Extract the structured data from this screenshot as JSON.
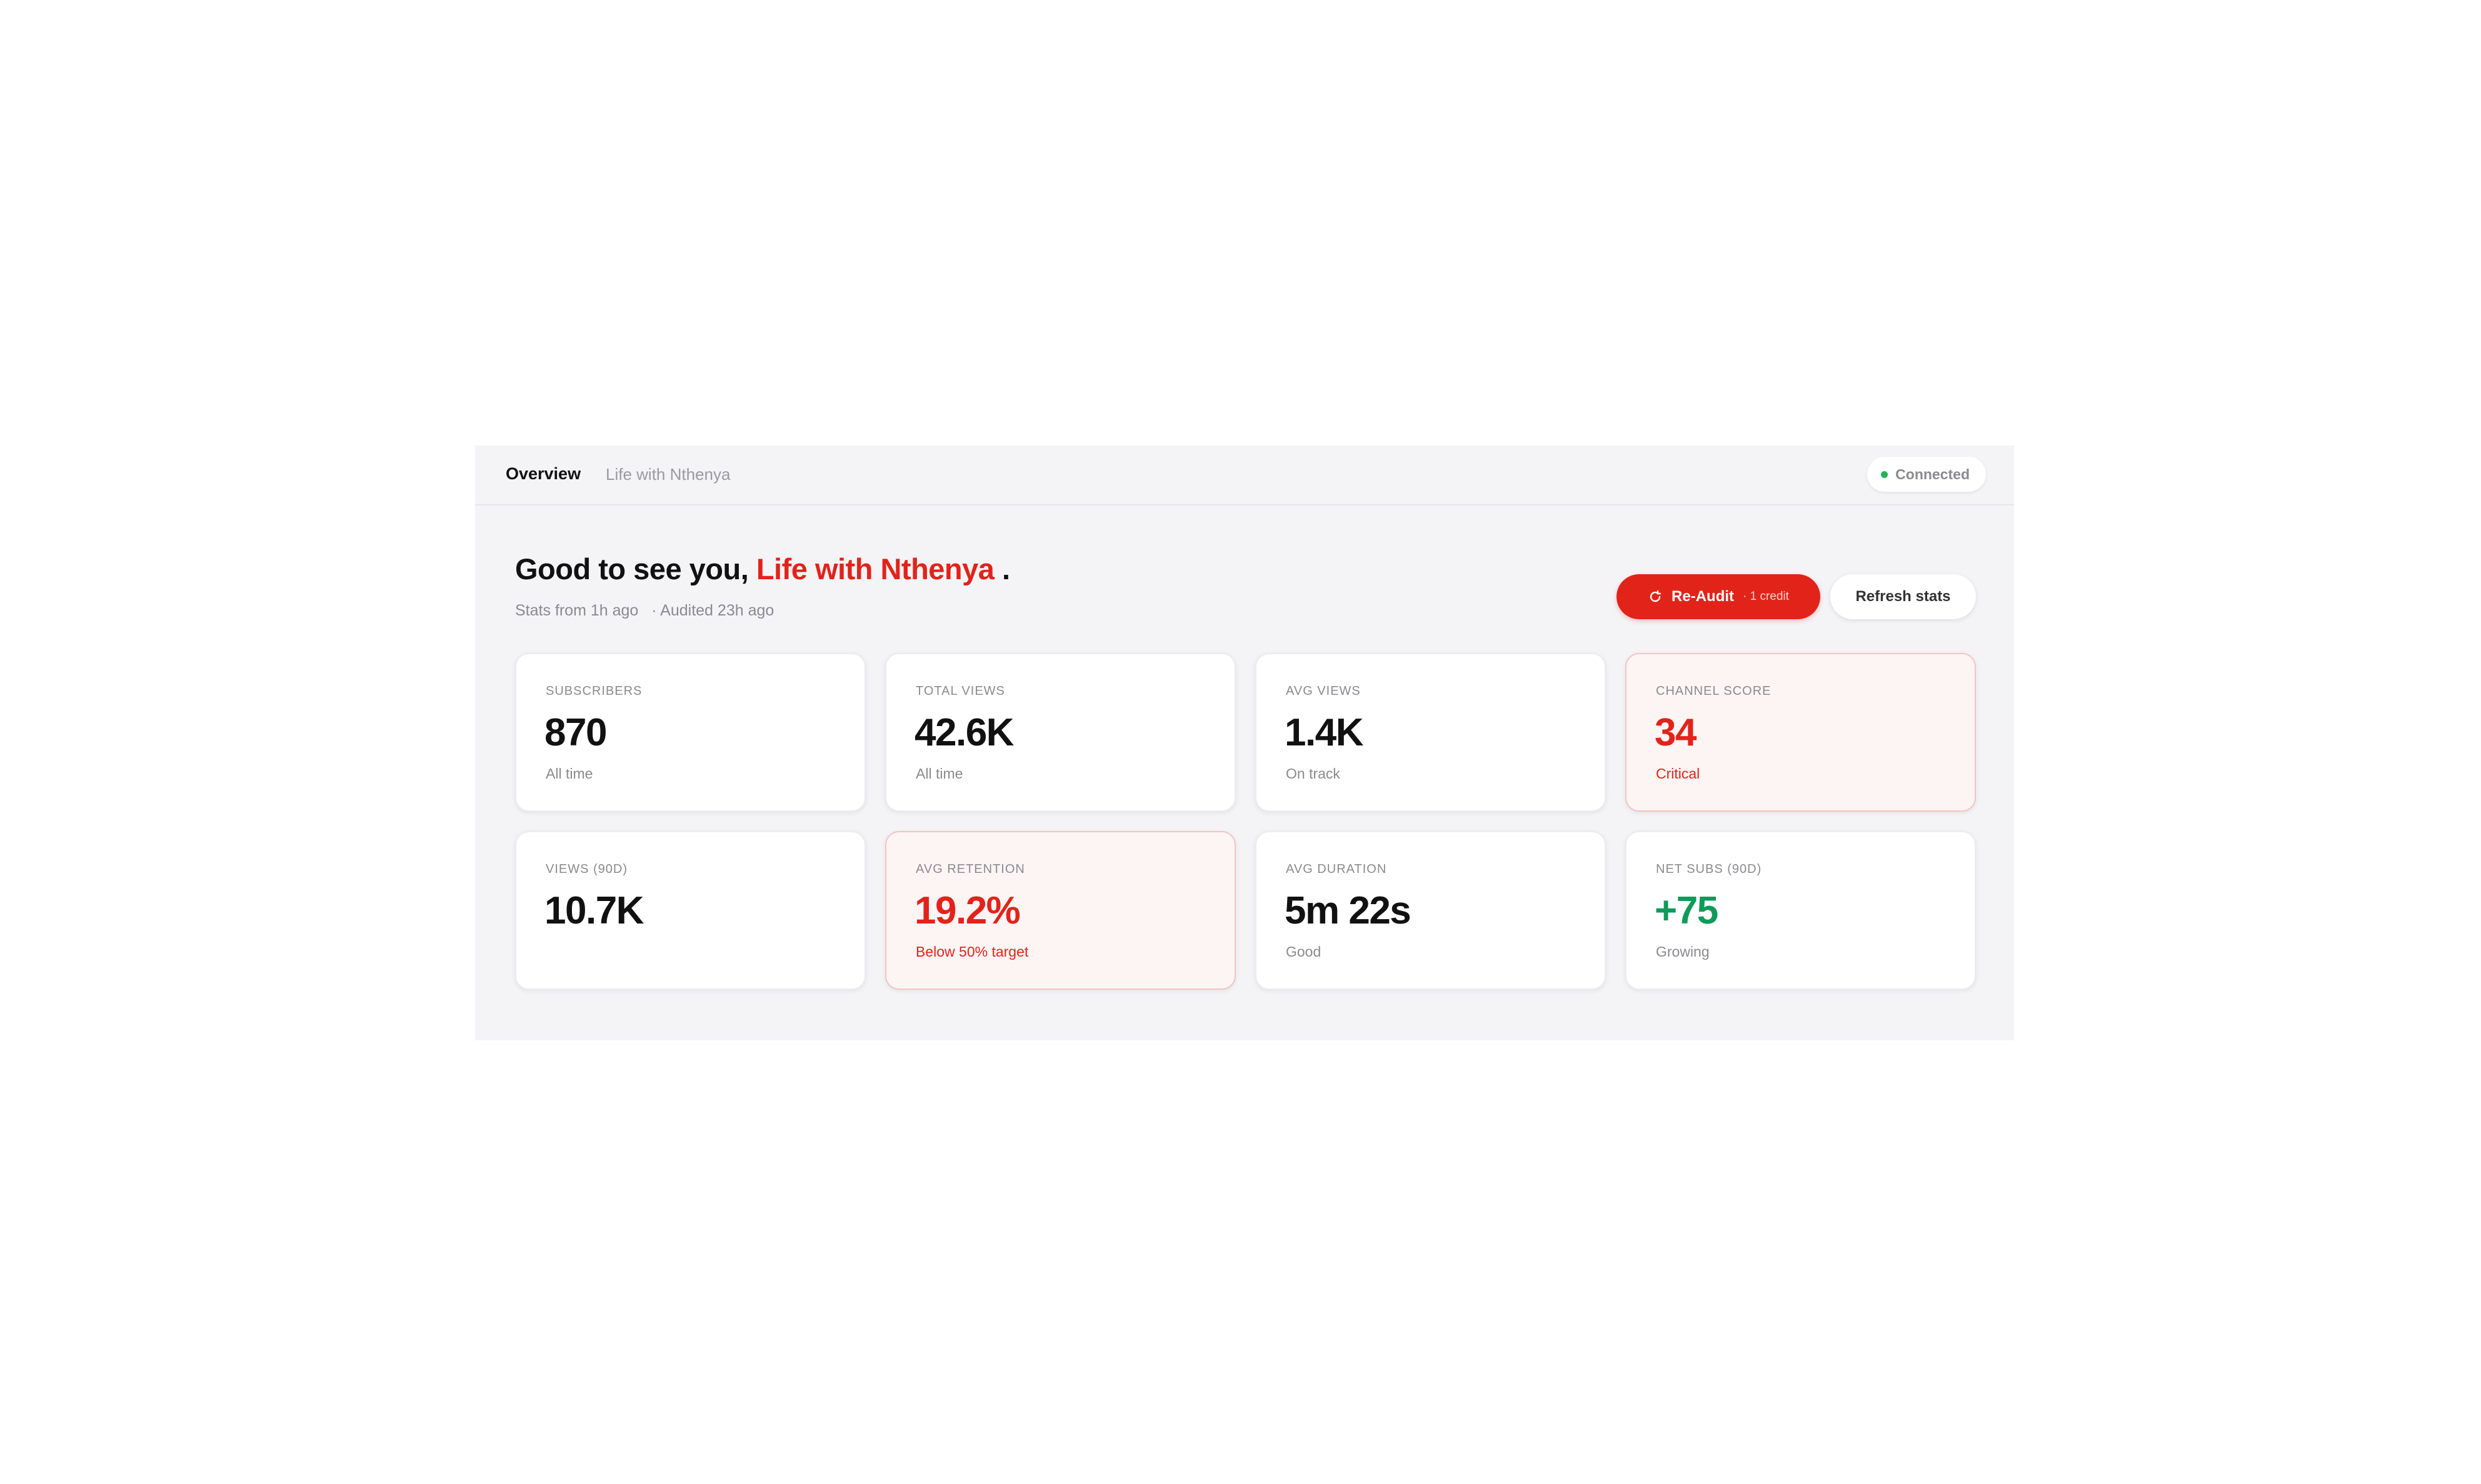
{
  "topbar": {
    "current": "Overview",
    "channel": "Life with Nthenya",
    "status": "Connected",
    "status_color": "#22b455"
  },
  "header": {
    "greeting_prefix": "Good to see you,",
    "channel_name": "Life with Nthenya",
    "greeting_suffix": ".",
    "stats_age": "Stats from 1h ago",
    "audit_age": "· Audited 23h ago"
  },
  "actions": {
    "reaudit_label": "Re-Audit",
    "reaudit_credit": "· 1 credit",
    "refresh_label": "Refresh stats"
  },
  "colors": {
    "accent": "#e2231a",
    "positive": "#0f9a5a",
    "muted": "#8a8a90"
  },
  "stats": {
    "subscribers": {
      "label": "SUBSCRIBERS",
      "value": "870",
      "note": "All time"
    },
    "total_views": {
      "label": "TOTAL VIEWS",
      "value": "42.6K",
      "note": "All time"
    },
    "avg_views": {
      "label": "AVG VIEWS",
      "value": "1.4K",
      "note": "On track"
    },
    "channel_score": {
      "label": "CHANNEL SCORE",
      "value": "34",
      "note": "Critical"
    },
    "views_90d": {
      "label": "VIEWS (90D)",
      "value": "10.7K",
      "note": ""
    },
    "avg_retention": {
      "label": "AVG RETENTION",
      "value": "19.2%",
      "note": "Below 50% target"
    },
    "avg_duration": {
      "label": "AVG DURATION",
      "value": "5m 22s",
      "note": "Good"
    },
    "net_subs_90d": {
      "label": "NET SUBS (90D)",
      "value": "+75",
      "note": "Growing"
    }
  }
}
